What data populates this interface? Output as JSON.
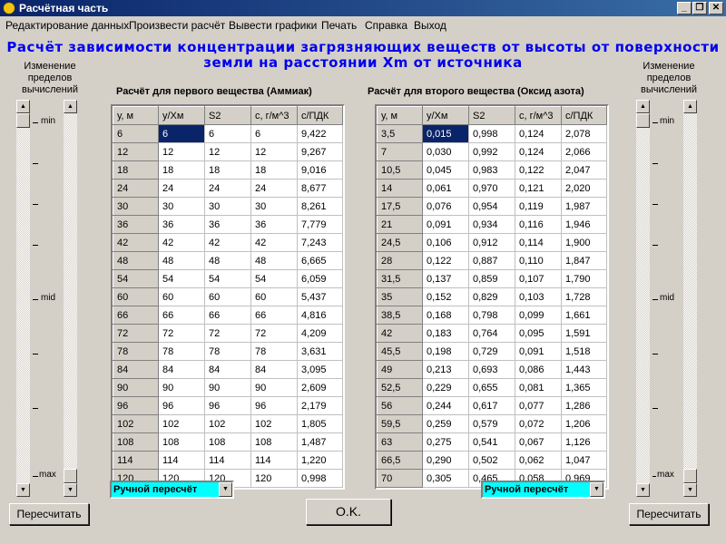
{
  "window": {
    "title": "Расчётная часть",
    "min": "_",
    "max": "❐",
    "close": "✕"
  },
  "menu": [
    "Редактирование данных",
    "Произвести расчёт",
    "Вывести графики",
    "Печать",
    "Справка",
    "Выход"
  ],
  "heading": {
    "line1": "Расчёт зависимости концентрации загрязняющих веществ от высоты от поверхности",
    "line2": "земли на расстоянии Xm от источника"
  },
  "left_panel": {
    "label": [
      "Изменение",
      "пределов",
      "вычислений"
    ],
    "ticks": [
      "min",
      "mid",
      "max"
    ],
    "button": "Пересчитать"
  },
  "right_panel": {
    "label": [
      "Изменение",
      "пределов",
      "вычислений"
    ],
    "ticks": [
      "min",
      "mid",
      "max"
    ],
    "button": "Пересчитать"
  },
  "table1": {
    "title": "Расчёт для первого вещества (Аммиак)",
    "headers": [
      "у, м",
      "у/Хм",
      "S2",
      "с, г/м^3",
      "с/ПДК"
    ],
    "rows": [
      [
        "6",
        "6",
        "6",
        "6",
        "9,422"
      ],
      [
        "12",
        "12",
        "12",
        "12",
        "9,267"
      ],
      [
        "18",
        "18",
        "18",
        "18",
        "9,016"
      ],
      [
        "24",
        "24",
        "24",
        "24",
        "8,677"
      ],
      [
        "30",
        "30",
        "30",
        "30",
        "8,261"
      ],
      [
        "36",
        "36",
        "36",
        "36",
        "7,779"
      ],
      [
        "42",
        "42",
        "42",
        "42",
        "7,243"
      ],
      [
        "48",
        "48",
        "48",
        "48",
        "6,665"
      ],
      [
        "54",
        "54",
        "54",
        "54",
        "6,059"
      ],
      [
        "60",
        "60",
        "60",
        "60",
        "5,437"
      ],
      [
        "66",
        "66",
        "66",
        "66",
        "4,816"
      ],
      [
        "72",
        "72",
        "72",
        "72",
        "4,209"
      ],
      [
        "78",
        "78",
        "78",
        "78",
        "3,631"
      ],
      [
        "84",
        "84",
        "84",
        "84",
        "3,095"
      ],
      [
        "90",
        "90",
        "90",
        "90",
        "2,609"
      ],
      [
        "96",
        "96",
        "96",
        "96",
        "2,179"
      ],
      [
        "102",
        "102",
        "102",
        "102",
        "1,805"
      ],
      [
        "108",
        "108",
        "108",
        "108",
        "1,487"
      ],
      [
        "114",
        "114",
        "114",
        "114",
        "1,220"
      ],
      [
        "120",
        "120",
        "120",
        "120",
        "0,998"
      ]
    ]
  },
  "table2": {
    "title": "Расчёт для второго вещества (Оксид азота)",
    "headers": [
      "у, м",
      "у/Хм",
      "S2",
      "с, г/м^3",
      "с/ПДК"
    ],
    "rows": [
      [
        "3,5",
        "0,015",
        "0,998",
        "0,124",
        "2,078"
      ],
      [
        "7",
        "0,030",
        "0,992",
        "0,124",
        "2,066"
      ],
      [
        "10,5",
        "0,045",
        "0,983",
        "0,122",
        "2,047"
      ],
      [
        "14",
        "0,061",
        "0,970",
        "0,121",
        "2,020"
      ],
      [
        "17,5",
        "0,076",
        "0,954",
        "0,119",
        "1,987"
      ],
      [
        "21",
        "0,091",
        "0,934",
        "0,116",
        "1,946"
      ],
      [
        "24,5",
        "0,106",
        "0,912",
        "0,114",
        "1,900"
      ],
      [
        "28",
        "0,122",
        "0,887",
        "0,110",
        "1,847"
      ],
      [
        "31,5",
        "0,137",
        "0,859",
        "0,107",
        "1,790"
      ],
      [
        "35",
        "0,152",
        "0,829",
        "0,103",
        "1,728"
      ],
      [
        "38,5",
        "0,168",
        "0,798",
        "0,099",
        "1,661"
      ],
      [
        "42",
        "0,183",
        "0,764",
        "0,095",
        "1,591"
      ],
      [
        "45,5",
        "0,198",
        "0,729",
        "0,091",
        "1,518"
      ],
      [
        "49",
        "0,213",
        "0,693",
        "0,086",
        "1,443"
      ],
      [
        "52,5",
        "0,229",
        "0,655",
        "0,081",
        "1,365"
      ],
      [
        "56",
        "0,244",
        "0,617",
        "0,077",
        "1,286"
      ],
      [
        "59,5",
        "0,259",
        "0,579",
        "0,072",
        "1,206"
      ],
      [
        "63",
        "0,275",
        "0,541",
        "0,067",
        "1,126"
      ],
      [
        "66,5",
        "0,290",
        "0,502",
        "0,062",
        "1,047"
      ],
      [
        "70",
        "0,305",
        "0,465",
        "0,058",
        "0,969"
      ]
    ]
  },
  "combo_left": "Ручной пересчёт",
  "combo_right": "Ручной пересчёт",
  "ok_button": "O.K.",
  "colors": {
    "heading": "#0000ee",
    "combo": "#00ffff",
    "selection": "#0a246a",
    "titlebar": "#0a246a"
  },
  "icons": {
    "app": "app-icon",
    "up": "arrow-up-icon",
    "down": "arrow-down-icon",
    "dropdown": "chevron-down-icon"
  }
}
